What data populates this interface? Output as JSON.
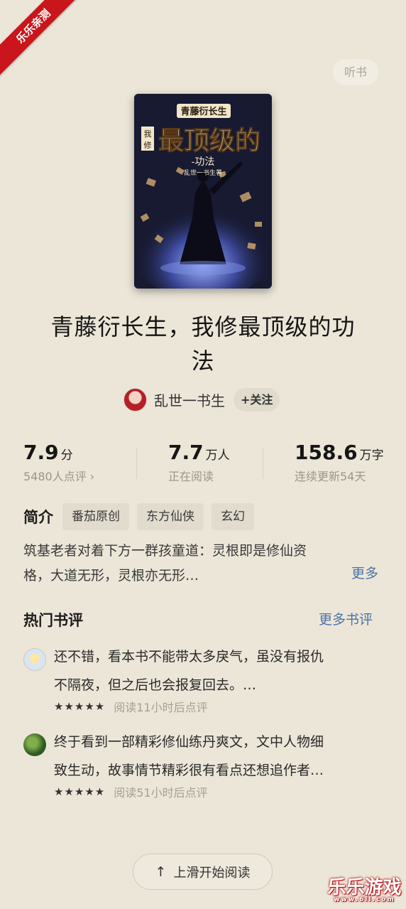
{
  "overlay": {
    "corner_badge": "乐乐亲测",
    "watermark_main": "乐乐游戏",
    "watermark_sub": "www.6ll.com"
  },
  "header": {
    "listen_label": "听书"
  },
  "book": {
    "cover_series": "青藤衍长生",
    "cover_prefix": "我修",
    "cover_main": "最顶级的",
    "cover_sub": "-功法",
    "cover_author": "乱世一书生著",
    "title_line1": "青藤衍长生，我修最顶级的功",
    "title_line2": "法"
  },
  "author": {
    "name": "乱世一书生",
    "follow_label": "+关注"
  },
  "stats": {
    "score": {
      "value": "7.9",
      "unit": "分",
      "sub": "5480人点评 ›"
    },
    "readers": {
      "value": "7.7",
      "unit": "万人",
      "sub": "正在阅读"
    },
    "words": {
      "value": "158.6",
      "unit": "万字",
      "sub": "连续更新54天"
    }
  },
  "intro": {
    "label": "简介",
    "tags": [
      "番茄原创",
      "东方仙侠",
      "玄幻"
    ],
    "text_line1": "筑基老者对着下方一群孩童道：灵根即是修仙资",
    "text_line2": "格，大道无形，灵根亦无形…",
    "more_label": "更多"
  },
  "reviews": {
    "title": "热门书评",
    "more_label": "更多书评",
    "items": [
      {
        "line1": "还不错，看本书不能带太多戾气，虽没有报仇",
        "line2": "不隔夜，但之后也会报复回去。…",
        "stars": "★★★★★",
        "info": "阅读11小时后点评"
      },
      {
        "line1": "终于看到一部精彩修仙练丹爽文，文中人物细",
        "line2": "致生动，故事情节精彩很有看点还想追作者…",
        "stars": "★★★★★",
        "info": "阅读51小时后点评"
      }
    ]
  },
  "footer": {
    "arrow": "↑",
    "swipe_label": "上滑开始阅读"
  },
  "colors": {
    "background": "#ece6d8",
    "link": "#4a73a8",
    "badge_red": "#c9151b"
  }
}
